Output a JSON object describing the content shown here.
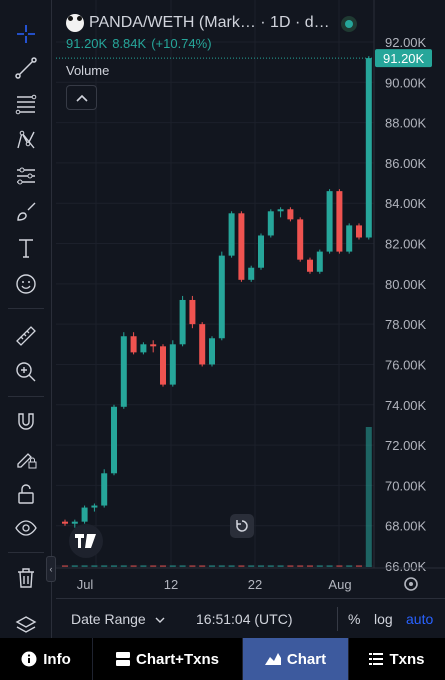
{
  "legend": {
    "pair": "PANDA/WETH (Mark…",
    "interval": "· 1D · d…",
    "last_price": "91.20K",
    "change": "8.84K",
    "change_pct": "(+10.74%)"
  },
  "volume_label": "Volume",
  "bottom_bar": {
    "date_range": "Date Range",
    "time": "16:51:04 (UTC)",
    "percent": "%",
    "log": "log",
    "auto": "auto"
  },
  "tabs": [
    {
      "label": "Info",
      "icon": "info-icon"
    },
    {
      "label": "Chart+Txns",
      "icon": "chart-txns-icon"
    },
    {
      "label": "Chart",
      "icon": "chart-icon"
    },
    {
      "label": "Txns",
      "icon": "list-icon"
    }
  ],
  "toolbar_icons": [
    "crosshair-icon",
    "trend-line-icon",
    "fib-retracement-icon",
    "pattern-icon",
    "prediction-icon",
    "brush-icon",
    "text-icon",
    "emoji-icon",
    "ruler-icon",
    "zoom-in-icon",
    "magnet-icon",
    "lock-drawing-icon",
    "lock-icon",
    "eye-icon",
    "trash-icon",
    "layers-icon"
  ],
  "colors": {
    "up": "#26a69a",
    "down": "#ef5350",
    "accent": "#2962ff",
    "background": "#12161f"
  },
  "chart_data": {
    "type": "candlestick",
    "price_axis_labels": [
      "92.00K",
      "90.00K",
      "88.00K",
      "86.00K",
      "84.00K",
      "82.00K",
      "80.00K",
      "78.00K",
      "76.00K",
      "74.00K",
      "72.00K",
      "70.00K",
      "68.00K",
      "66.00K"
    ],
    "time_axis_labels": [
      "Jul",
      "12",
      "22",
      "Aug"
    ],
    "last_price_label": "91.20K",
    "ylim": [
      66000,
      92000
    ],
    "candles": [
      {
        "open": 68200,
        "high": 68300,
        "low": 68000,
        "close": 68100
      },
      {
        "open": 68100,
        "high": 68300,
        "low": 67900,
        "close": 68200
      },
      {
        "open": 68200,
        "high": 69000,
        "low": 68100,
        "close": 68900
      },
      {
        "open": 68900,
        "high": 69100,
        "low": 68700,
        "close": 69000
      },
      {
        "open": 69000,
        "high": 70800,
        "low": 68900,
        "close": 70600
      },
      {
        "open": 70600,
        "high": 74000,
        "low": 70500,
        "close": 73900
      },
      {
        "open": 73900,
        "high": 77600,
        "low": 73800,
        "close": 77400
      },
      {
        "open": 77400,
        "high": 77600,
        "low": 76500,
        "close": 76600
      },
      {
        "open": 76600,
        "high": 77100,
        "low": 76500,
        "close": 77000
      },
      {
        "open": 77000,
        "high": 77200,
        "low": 76600,
        "close": 76900
      },
      {
        "open": 76900,
        "high": 77000,
        "low": 74900,
        "close": 75000
      },
      {
        "open": 75000,
        "high": 77200,
        "low": 74900,
        "close": 77000
      },
      {
        "open": 77000,
        "high": 79400,
        "low": 76900,
        "close": 79200
      },
      {
        "open": 79200,
        "high": 79400,
        "low": 77800,
        "close": 78000
      },
      {
        "open": 78000,
        "high": 78100,
        "low": 75900,
        "close": 76000
      },
      {
        "open": 76000,
        "high": 77400,
        "low": 75900,
        "close": 77300
      },
      {
        "open": 77300,
        "high": 81600,
        "low": 77200,
        "close": 81400
      },
      {
        "open": 81400,
        "high": 83600,
        "low": 81300,
        "close": 83500
      },
      {
        "open": 83500,
        "high": 83600,
        "low": 80100,
        "close": 80200
      },
      {
        "open": 80200,
        "high": 80900,
        "low": 80100,
        "close": 80800
      },
      {
        "open": 80800,
        "high": 82500,
        "low": 80700,
        "close": 82400
      },
      {
        "open": 82400,
        "high": 83700,
        "low": 82300,
        "close": 83600
      },
      {
        "open": 83600,
        "high": 83800,
        "low": 83300,
        "close": 83700
      },
      {
        "open": 83700,
        "high": 83800,
        "low": 83100,
        "close": 83200
      },
      {
        "open": 83200,
        "high": 83300,
        "low": 81100,
        "close": 81200
      },
      {
        "open": 81200,
        "high": 81300,
        "low": 80500,
        "close": 80600
      },
      {
        "open": 80600,
        "high": 81700,
        "low": 80500,
        "close": 81600
      },
      {
        "open": 81600,
        "high": 84700,
        "low": 81500,
        "close": 84600
      },
      {
        "open": 84600,
        "high": 84700,
        "low": 81500,
        "close": 81600
      },
      {
        "open": 81600,
        "high": 83000,
        "low": 81500,
        "close": 82900
      },
      {
        "open": 82900,
        "high": 83000,
        "low": 82200,
        "close": 82300
      },
      {
        "open": 82300,
        "high": 91300,
        "low": 82200,
        "close": 91200
      }
    ],
    "volumes": [
      0.4,
      0.4,
      0.4,
      0.4,
      0.4,
      0.4,
      0.4,
      0.4,
      0.4,
      0.4,
      0.4,
      0.4,
      0.4,
      0.4,
      0.4,
      0.4,
      0.4,
      0.4,
      0.4,
      0.4,
      0.4,
      0.4,
      0.4,
      0.4,
      0.4,
      0.4,
      0.4,
      0.4,
      0.4,
      0.4,
      0.4,
      32
    ]
  }
}
